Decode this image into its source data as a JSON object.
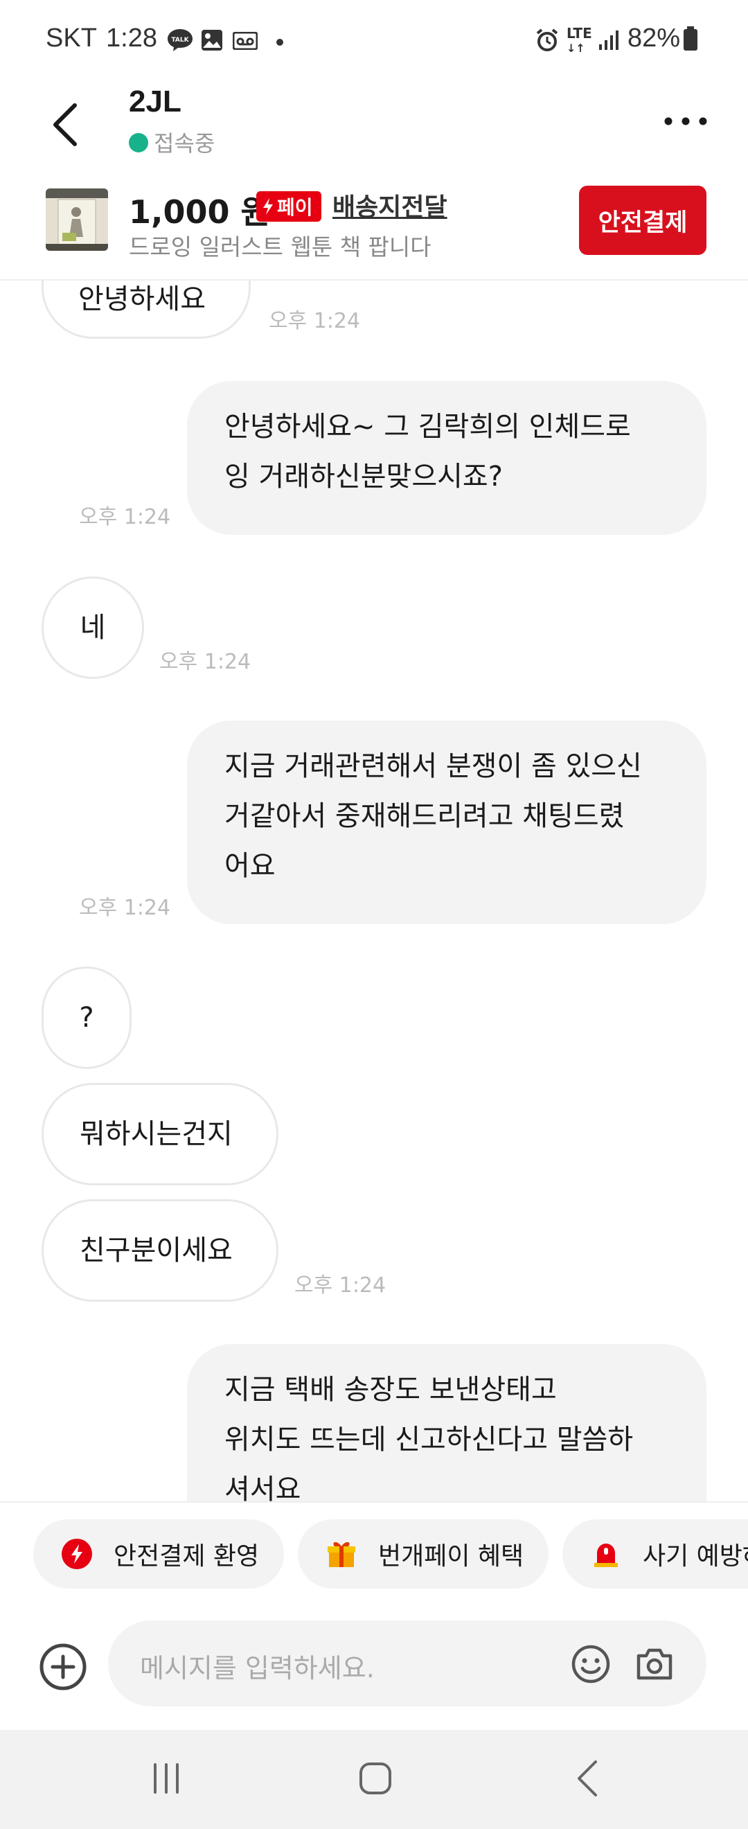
{
  "status_bar": {
    "carrier": "SKT",
    "time": "1:28",
    "network": "LTE",
    "battery": "82%",
    "icons": [
      "talk-icon",
      "gallery-icon",
      "voicemail-icon",
      "dot-icon",
      "alarm-icon",
      "lte-icon",
      "signal-icon",
      "battery-icon"
    ]
  },
  "header": {
    "peer_name": "2JL",
    "status": "접속중",
    "status_color": "#17b28a"
  },
  "product": {
    "price": "1,000 원",
    "pay_badge": "페이",
    "shipping": "배송지전달",
    "title": "드로잉 일러스트 웹툰 책 팝니다",
    "safe_pay_button": "안전결제",
    "accent": "#d8101e"
  },
  "messages": [
    {
      "side": "left",
      "text": "안녕하세요",
      "time": "오후 1:24"
    },
    {
      "side": "right",
      "lines": [
        "안녕하세요~  그 김락희의 인체드로",
        "잉 거래하신분맞으시죠?"
      ],
      "time": "오후 1:24"
    },
    {
      "side": "left",
      "text": "네",
      "time": "오후 1:24"
    },
    {
      "side": "right",
      "lines": [
        "지금 거래관련해서 분쟁이 좀 있으신",
        "거같아서 중재해드리려고 채팅드렸",
        "어요"
      ],
      "time": "오후 1:24"
    },
    {
      "side": "left",
      "text": "?"
    },
    {
      "side": "left",
      "text": "뭐하시는건지"
    },
    {
      "side": "left",
      "text": "친구분이세요",
      "time": "오후 1:24"
    },
    {
      "side": "right",
      "lines": [
        "지금 택배 송장도 보낸상태고",
        "위치도 뜨는데 신고하신다고 말씀하",
        "셔서요"
      ]
    }
  ],
  "chips": [
    {
      "label": "안전결제 환영",
      "icon": "lightning-icon"
    },
    {
      "label": "번개페이 혜택",
      "icon": "gift-icon"
    },
    {
      "label": "사기 예방하기",
      "icon": "siren-icon"
    }
  ],
  "input": {
    "placeholder": "메시지를 입력하세요."
  }
}
